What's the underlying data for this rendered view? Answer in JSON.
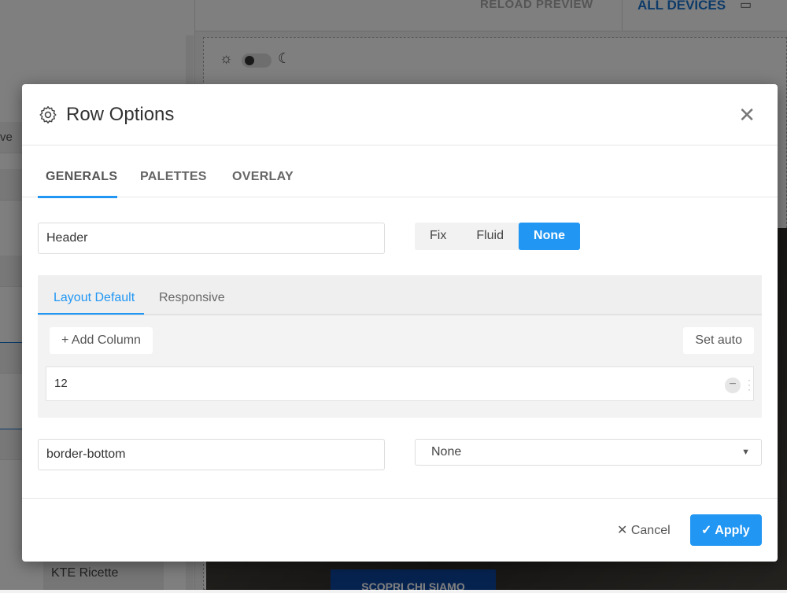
{
  "background": {
    "left_partial_text": "ve",
    "left_item": "KTE Ricette",
    "reload_label": "RELOAD PREVIEW",
    "all_devices_label": "ALL DEVICES",
    "preview_button": "SCOPRI CHI SIAMO"
  },
  "dialog": {
    "title": "Row Options",
    "tabs": [
      "GENERALS",
      "PALETTES",
      "OVERLAY"
    ],
    "name_value": "Header",
    "width_options": [
      "Fix",
      "Fluid",
      "None"
    ],
    "width_selected": "None",
    "layout_tabs": [
      "Layout Default",
      "Responsive"
    ],
    "add_column_label": "+ Add Column",
    "set_auto_label": "Set auto",
    "column_value": "12",
    "class_value": "border-bottom",
    "border_select": "None",
    "cancel_label": "✕ Cancel",
    "apply_label": "✓ Apply"
  },
  "colors": {
    "accent": "#2196f3",
    "overlay": "rgba(0,0,0,0.5)"
  }
}
